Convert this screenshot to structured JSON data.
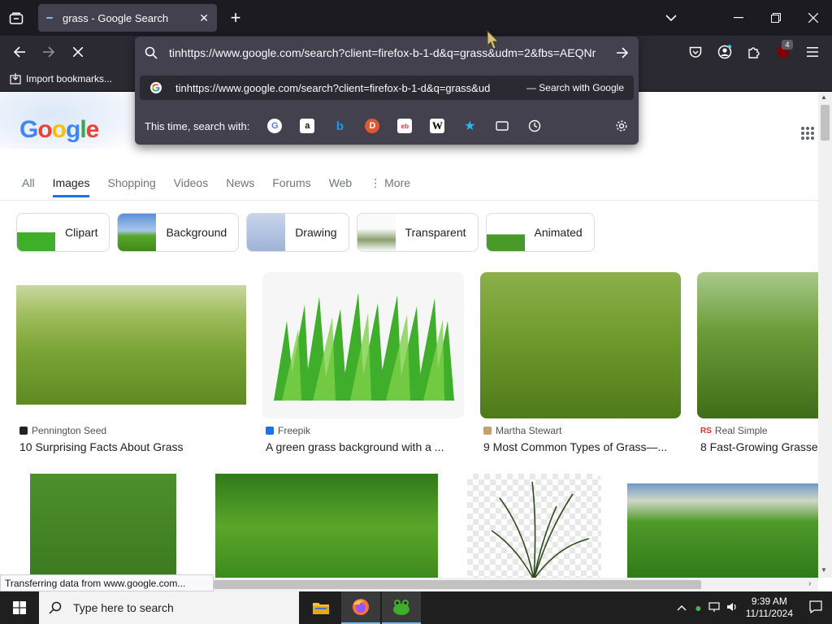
{
  "browser": {
    "tab_title": "grass - Google Search",
    "url_typed": "tinhttps://www.google.com/search?client=firefox-b-1-d&q=grass&udm=2&fbs=AEQNr",
    "suggestion_text": "tinhttps://www.google.com/search?client=firefox-b-1-d&q=grass&ud",
    "suggestion_action": "— Search with Google",
    "engines_label": "This time, search with:",
    "bookmark_label": "Import bookmarks...",
    "extension_badge": "4"
  },
  "google": {
    "logo": [
      "G",
      "o",
      "o",
      "g",
      "l",
      "e"
    ],
    "logo_colors": [
      "#4285f4",
      "#ea4335",
      "#fbbc05",
      "#4285f4",
      "#34a853",
      "#ea4335"
    ],
    "tabs": [
      "All",
      "Images",
      "Shopping",
      "Videos",
      "News",
      "Forums",
      "Web",
      "More"
    ],
    "active_tab": "Images",
    "chips": [
      "Clipart",
      "Background",
      "Drawing",
      "Transparent",
      "Animated"
    ],
    "results": [
      {
        "source": "Pennington Seed",
        "title": "10 Surprising Facts About Grass"
      },
      {
        "source": "Freepik",
        "title": "A green grass background with a ..."
      },
      {
        "source": "Martha Stewart",
        "title": "9 Most Common Types of Grass—..."
      },
      {
        "source": "Real Simple",
        "title": "8 Fast-Growing Grasse"
      }
    ]
  },
  "status_bar": "Transferring data from www.google.com...",
  "taskbar": {
    "search_placeholder": "Type here to search",
    "time": "9:39 AM",
    "date": "11/11/2024"
  }
}
